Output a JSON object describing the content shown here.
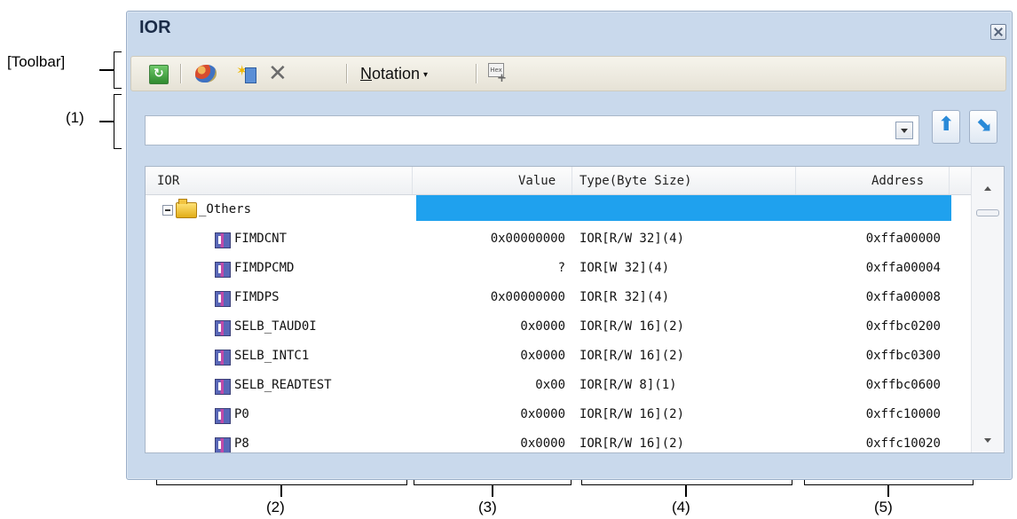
{
  "annotations": {
    "toolbar": "[Toolbar]",
    "area1": "(1)",
    "area2": "(2)",
    "area3": "(3)",
    "area4": "(4)",
    "area5": "(5)"
  },
  "window": {
    "title": "IOR"
  },
  "toolbar": {
    "refresh_icon": "refresh-icon",
    "color_icon": "palette-icon",
    "new_icon": "new-category-icon",
    "delete_icon": "delete-icon",
    "notation_label_underlined": "N",
    "notation_label_rest": "otation",
    "notation_caret": "▾",
    "hex_icon_text": "Hex"
  },
  "search": {
    "value": ""
  },
  "grid": {
    "headers": {
      "ior": "IOR",
      "value": "Value",
      "type": "Type(Byte Size)",
      "address": "Address"
    },
    "group": "_Others",
    "rows": [
      {
        "name": "FIMDCNT",
        "value": "0x00000000",
        "type": "IOR[R/W 32](4)",
        "address": "0xffa00000"
      },
      {
        "name": "FIMDPCMD",
        "value": "?",
        "type": "IOR[W 32](4)",
        "address": "0xffa00004"
      },
      {
        "name": "FIMDPS",
        "value": "0x00000000",
        "type": "IOR[R 32](4)",
        "address": "0xffa00008"
      },
      {
        "name": "SELB_TAUD0I",
        "value": "0x0000",
        "type": "IOR[R/W 16](2)",
        "address": "0xffbc0200"
      },
      {
        "name": "SELB_INTC1",
        "value": "0x0000",
        "type": "IOR[R/W 16](2)",
        "address": "0xffbc0300"
      },
      {
        "name": "SELB_READTEST",
        "value": "0x00",
        "type": "IOR[R/W 8](1)",
        "address": "0xffbc0600"
      },
      {
        "name": "P0",
        "value": "0x0000",
        "type": "IOR[R/W 16](2)",
        "address": "0xffc10000"
      },
      {
        "name": "P8",
        "value": "0x0000",
        "type": "IOR[R/W 16](2)",
        "address": "0xffc10020"
      }
    ]
  },
  "colors": {
    "selection": "#1fa1ee",
    "window_frame": "#c9d9ec"
  }
}
